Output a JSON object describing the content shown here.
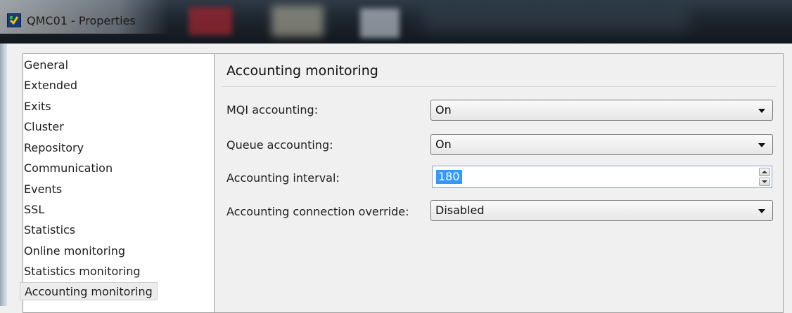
{
  "window": {
    "title": "QMC01 - Properties",
    "icon": "queue-manager-icon"
  },
  "nav": {
    "items": [
      {
        "label": "General"
      },
      {
        "label": "Extended"
      },
      {
        "label": "Exits"
      },
      {
        "label": "Cluster"
      },
      {
        "label": "Repository"
      },
      {
        "label": "Communication"
      },
      {
        "label": "Events"
      },
      {
        "label": "SSL"
      },
      {
        "label": "Statistics"
      },
      {
        "label": "Online monitoring"
      },
      {
        "label": "Statistics monitoring"
      },
      {
        "label": "Accounting monitoring"
      }
    ],
    "selected": "Accounting monitoring"
  },
  "panel": {
    "title": "Accounting monitoring",
    "fields": {
      "mqi_accounting": {
        "label": "MQI accounting:",
        "value": "On"
      },
      "queue_accounting": {
        "label": "Queue accounting:",
        "value": "On"
      },
      "accounting_interval": {
        "label": "Accounting interval:",
        "value": "180"
      },
      "connection_override": {
        "label": "Accounting connection override:",
        "value": "Disabled"
      }
    }
  },
  "colors": {
    "selection_highlight": "#3399ff",
    "panel_background": "#f0f0f0"
  }
}
